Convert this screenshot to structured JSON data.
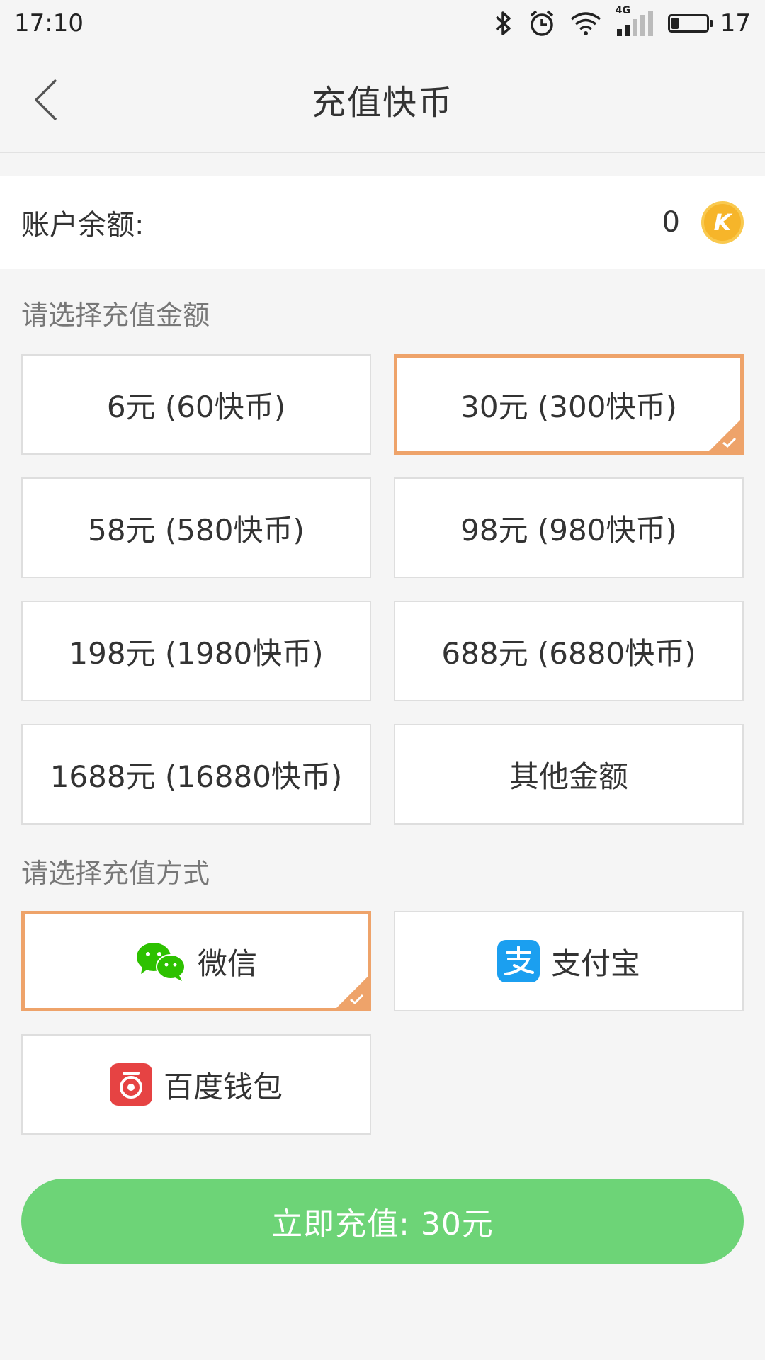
{
  "status_bar": {
    "time": "17:10",
    "network": "4G",
    "battery_level": "17"
  },
  "header": {
    "title": "充值快币"
  },
  "balance": {
    "label": "账户余额:",
    "value": "0",
    "coin_letter": "K"
  },
  "amount_section": {
    "title": "请选择充值金额",
    "options": [
      "6元 (60快币)",
      "30元 (300快币)",
      "58元 (580快币)",
      "98元 (980快币)",
      "198元 (1980快币)",
      "688元 (6880快币)",
      "1688元 (16880快币)",
      "其他金额"
    ],
    "selected_index": 1
  },
  "payment_section": {
    "title": "请选择充值方式",
    "methods": [
      "微信",
      "支付宝",
      "百度钱包"
    ],
    "selected_index": 0
  },
  "action": {
    "recharge_label": "立即充值: 30元"
  },
  "colors": {
    "accent_border": "#eea36a",
    "button_green": "#6dd477",
    "wechat_green": "#2dc100",
    "alipay_blue": "#1b9ff0",
    "baidu_red": "#e64343",
    "coin_gold": "#f6b52a"
  }
}
